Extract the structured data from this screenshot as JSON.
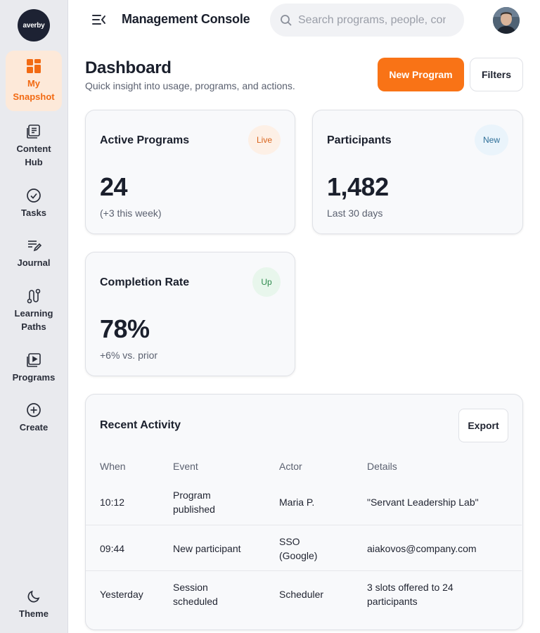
{
  "sidebar": {
    "logo_text": "averby",
    "items": [
      {
        "label": "My Snapshot",
        "icon": "grid-icon",
        "active": true
      },
      {
        "label": "Content Hub",
        "icon": "document-icon"
      },
      {
        "label": "Tasks",
        "icon": "check-circle-icon"
      },
      {
        "label": "Journal",
        "icon": "pencil-lines-icon"
      },
      {
        "label": "Learning Paths",
        "icon": "route-icon"
      },
      {
        "label": "Programs",
        "icon": "play-icon"
      },
      {
        "label": "Create",
        "icon": "plus-circle-icon"
      }
    ],
    "theme_label": "Theme"
  },
  "header": {
    "title": "Management Console",
    "search_placeholder": "Search programs, people, content…"
  },
  "page": {
    "title": "Dashboard",
    "subtitle": "Quick insight into usage, programs, and actions.",
    "new_program_label": "New Program",
    "filters_label": "Filters"
  },
  "cards": [
    {
      "title": "Active Programs",
      "badge": "Live",
      "value": "24",
      "note": "(+3 this week)"
    },
    {
      "title": "Participants",
      "badge": "New",
      "value": "1,482",
      "note": "Last 30 days"
    },
    {
      "title": "Completion Rate",
      "badge": "Up",
      "value": "78%",
      "note": "+6% vs. prior"
    }
  ],
  "activity": {
    "title": "Recent Activity",
    "export_label": "Export",
    "columns": [
      "When",
      "Event",
      "Actor",
      "Details"
    ],
    "rows": [
      {
        "when": "10:12",
        "event": "Program published",
        "actor": "Maria P.",
        "details": "\"Servant Leadership Lab\""
      },
      {
        "when": "09:44",
        "event": "New participant",
        "actor": "SSO (Google)",
        "details": "aiakovos@company.com"
      },
      {
        "when": "Yesterday",
        "event": "Session scheduled",
        "actor": "Scheduler",
        "details": "3 slots offered to 24 participants"
      }
    ]
  },
  "colors": {
    "accent": "#f97316",
    "sidebar_bg": "#e9eaee",
    "active_bg": "#fde9d9",
    "badge_live": "#fdf0e6",
    "badge_new": "#eaf4fb",
    "badge_up": "#e8f6ec"
  }
}
